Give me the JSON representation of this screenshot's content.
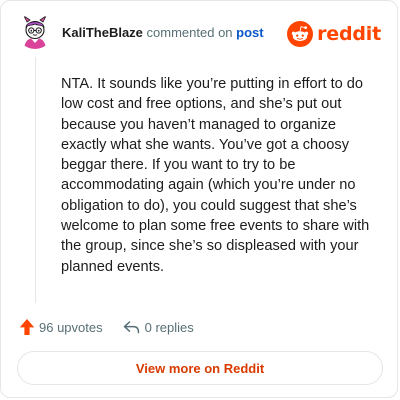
{
  "header": {
    "username": "KaliTheBlaze",
    "commented_text": "commented on",
    "post_link": "post",
    "brand_word": "reddit"
  },
  "comment": {
    "body": "NTA. It sounds like you’re putting in effort to do low cost and free options, and she’s put out because you haven’t managed to organize exactly what she wants. You’ve got a choosy beggar there. If you want to try to be accommodating again (which you’re under no obligation to do), you could suggest that she’s welcome to plan some free events to share with the group, since she’s so displeased with your planned events."
  },
  "actions": {
    "upvotes": "96 upvotes",
    "replies": "0 replies"
  },
  "footer": {
    "view_more": "View more on Reddit"
  },
  "icons": {
    "avatar": "avatar-icon",
    "brand": "reddit-logo-icon",
    "upvote": "upvote-arrow-icon",
    "reply": "reply-arrow-icon"
  },
  "colors": {
    "brand": "#ff4500",
    "link": "#0a58ca",
    "view_more": "#d93a00",
    "meta": "#576f76",
    "border": "#e4e6e8"
  }
}
